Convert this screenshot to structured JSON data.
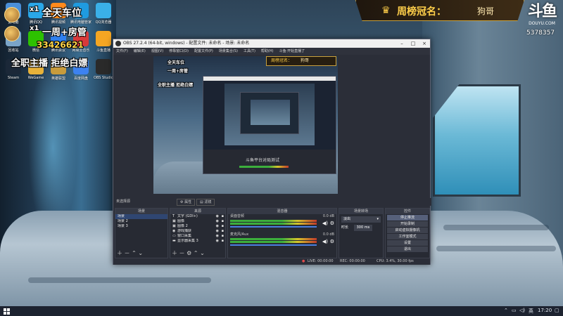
{
  "stream": {
    "gifts": [
      {
        "count": "x1",
        "text": "全天车位"
      },
      {
        "count": "x1",
        "text": "一周+房管"
      }
    ],
    "fan_id": "33426621",
    "tagline": "全职主播  拒绝白嫖",
    "weekly_title": "周榜冠名：",
    "weekly_name": "狗哥",
    "logo_text": "斗鱼",
    "logo_domain": "DOUYU.COM",
    "room_id": "5378357"
  },
  "desktop_icons": [
    {
      "label": "此电脑",
      "icon": "computer-icon",
      "color": "#4a8fd8"
    },
    {
      "label": "腾讯QQ",
      "icon": "qq-icon",
      "color": "#2aa7e8"
    },
    {
      "label": "腾讯视频",
      "icon": "video-icon",
      "color": "#ff8a1c"
    },
    {
      "label": "腾讯电脑管家",
      "icon": "shield-icon",
      "color": "#1f9be0"
    },
    {
      "label": "QQ浏览器",
      "icon": "browser-icon",
      "color": "#3ab0e8"
    },
    {
      "label": "回收站",
      "icon": "recycle-bin-icon",
      "color": "#7aa4c8"
    },
    {
      "label": "微信",
      "icon": "wechat-icon",
      "color": "#2dc100"
    },
    {
      "label": "腾讯会议",
      "icon": "meeting-icon",
      "color": "#2f7fee"
    },
    {
      "label": "网易云音乐",
      "icon": "music-icon",
      "color": "#d83a3a"
    },
    {
      "label": "斗鱼直播",
      "icon": "douyu-icon",
      "color": "#f5a623"
    },
    {
      "label": "Steam",
      "icon": "steam-icon",
      "color": "#1b2838"
    },
    {
      "label": "WeGame",
      "icon": "wegame-icon",
      "color": "#e8b23a"
    },
    {
      "label": "英雄联盟",
      "icon": "lol-icon",
      "color": "#c89b3c"
    },
    {
      "label": "百度网盘",
      "icon": "cloud-icon",
      "color": "#3d82f0"
    },
    {
      "label": "OBS Studio",
      "icon": "obs-icon",
      "color": "#2a2a2a"
    }
  ],
  "obs": {
    "title": "OBS 27.2.4 (64-bit, windows) - 配置文件: 未命名 - 场景: 未命名",
    "menu": [
      "文件(F)",
      "编辑(E)",
      "视图(V)",
      "停靠窗口(D)",
      "配置文件(P)",
      "场景集合(S)",
      "工具(T)",
      "帮助(H)",
      "斗鱼·开始直播了"
    ],
    "no_source_label": "未选择源",
    "properties_label": "属性",
    "filters_label": "滤镜",
    "docks": {
      "scenes": {
        "header": "场景",
        "items": [
          "场景",
          "场景 2",
          "场景 3"
        ]
      },
      "sources": {
        "header": "来源",
        "items": [
          "文字 (GDI+)",
          "图像",
          "图像 2",
          "游戏捕获",
          "窗口采集",
          "显示器采集 3"
        ]
      },
      "mixer": {
        "header": "混音器",
        "channels": [
          {
            "name": "桌面音频",
            "db": "0.0 dB"
          },
          {
            "name": "麦克风/Aux",
            "db": "0.0 dB"
          }
        ]
      },
      "transitions": {
        "header": "场景转场",
        "type": "淡出",
        "duration_label": "时长",
        "duration": "300 ms"
      },
      "controls": {
        "header": "控件",
        "buttons": [
          "停止推流",
          "开始录制",
          "启动虚拟摄像机",
          "工作室模式",
          "设置",
          "退出"
        ]
      }
    },
    "status": {
      "live": "LIVE: 00:00:00",
      "rec": "REC: 00:00:00",
      "cpu": "CPU: 3.4%, 30.00 fps"
    },
    "inner_caption": "斗鱼平台对局测试"
  },
  "taskbar": {
    "time": "17:20",
    "tray_icons": [
      "chevron-up-icon",
      "network-icon",
      "volume-icon",
      "language-icon"
    ]
  }
}
